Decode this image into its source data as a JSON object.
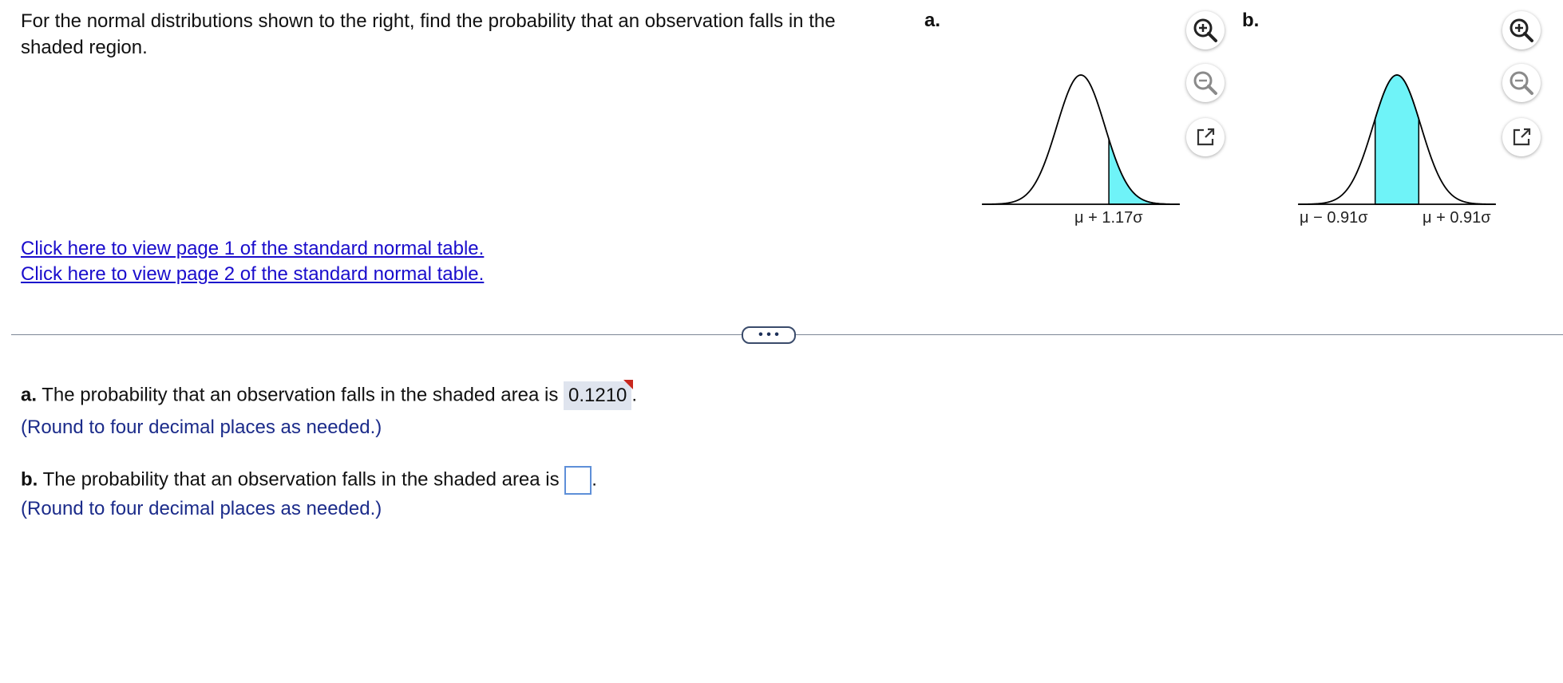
{
  "question": {
    "text": "For the normal distributions shown to the right, find the probability that an observation falls in the shaded region."
  },
  "links": [
    "Click here to view page 1 of the standard normal table.",
    "Click here to view page 2 of the standard normal table."
  ],
  "figures": {
    "a": {
      "label": "a.",
      "tick_labels": [
        "μ + 1.17σ"
      ],
      "shading": "right tail beyond μ + 1.17σ",
      "icons": [
        "zoom-in-icon",
        "zoom-out-icon",
        "popout-icon"
      ]
    },
    "b": {
      "label": "b.",
      "tick_labels": [
        "μ − 0.91σ",
        "μ + 0.91σ"
      ],
      "shading": "central region between μ − 0.91σ and μ + 0.91σ",
      "icons": [
        "zoom-in-icon",
        "zoom-out-icon",
        "popout-icon"
      ]
    },
    "fill_color": "#6ff3f8"
  },
  "divider_button": "• • •",
  "answers": {
    "a": {
      "label": "a.",
      "text": "The probability that an observation falls in the shaded area is",
      "value": "0.1210",
      "suffix": ".",
      "hint": "(Round to four decimal places as needed.)"
    },
    "b": {
      "label": "b.",
      "text": "The probability that an observation falls in the shaded area is",
      "value": "",
      "suffix": ".",
      "hint": "(Round to four decimal places as needed.)"
    }
  }
}
